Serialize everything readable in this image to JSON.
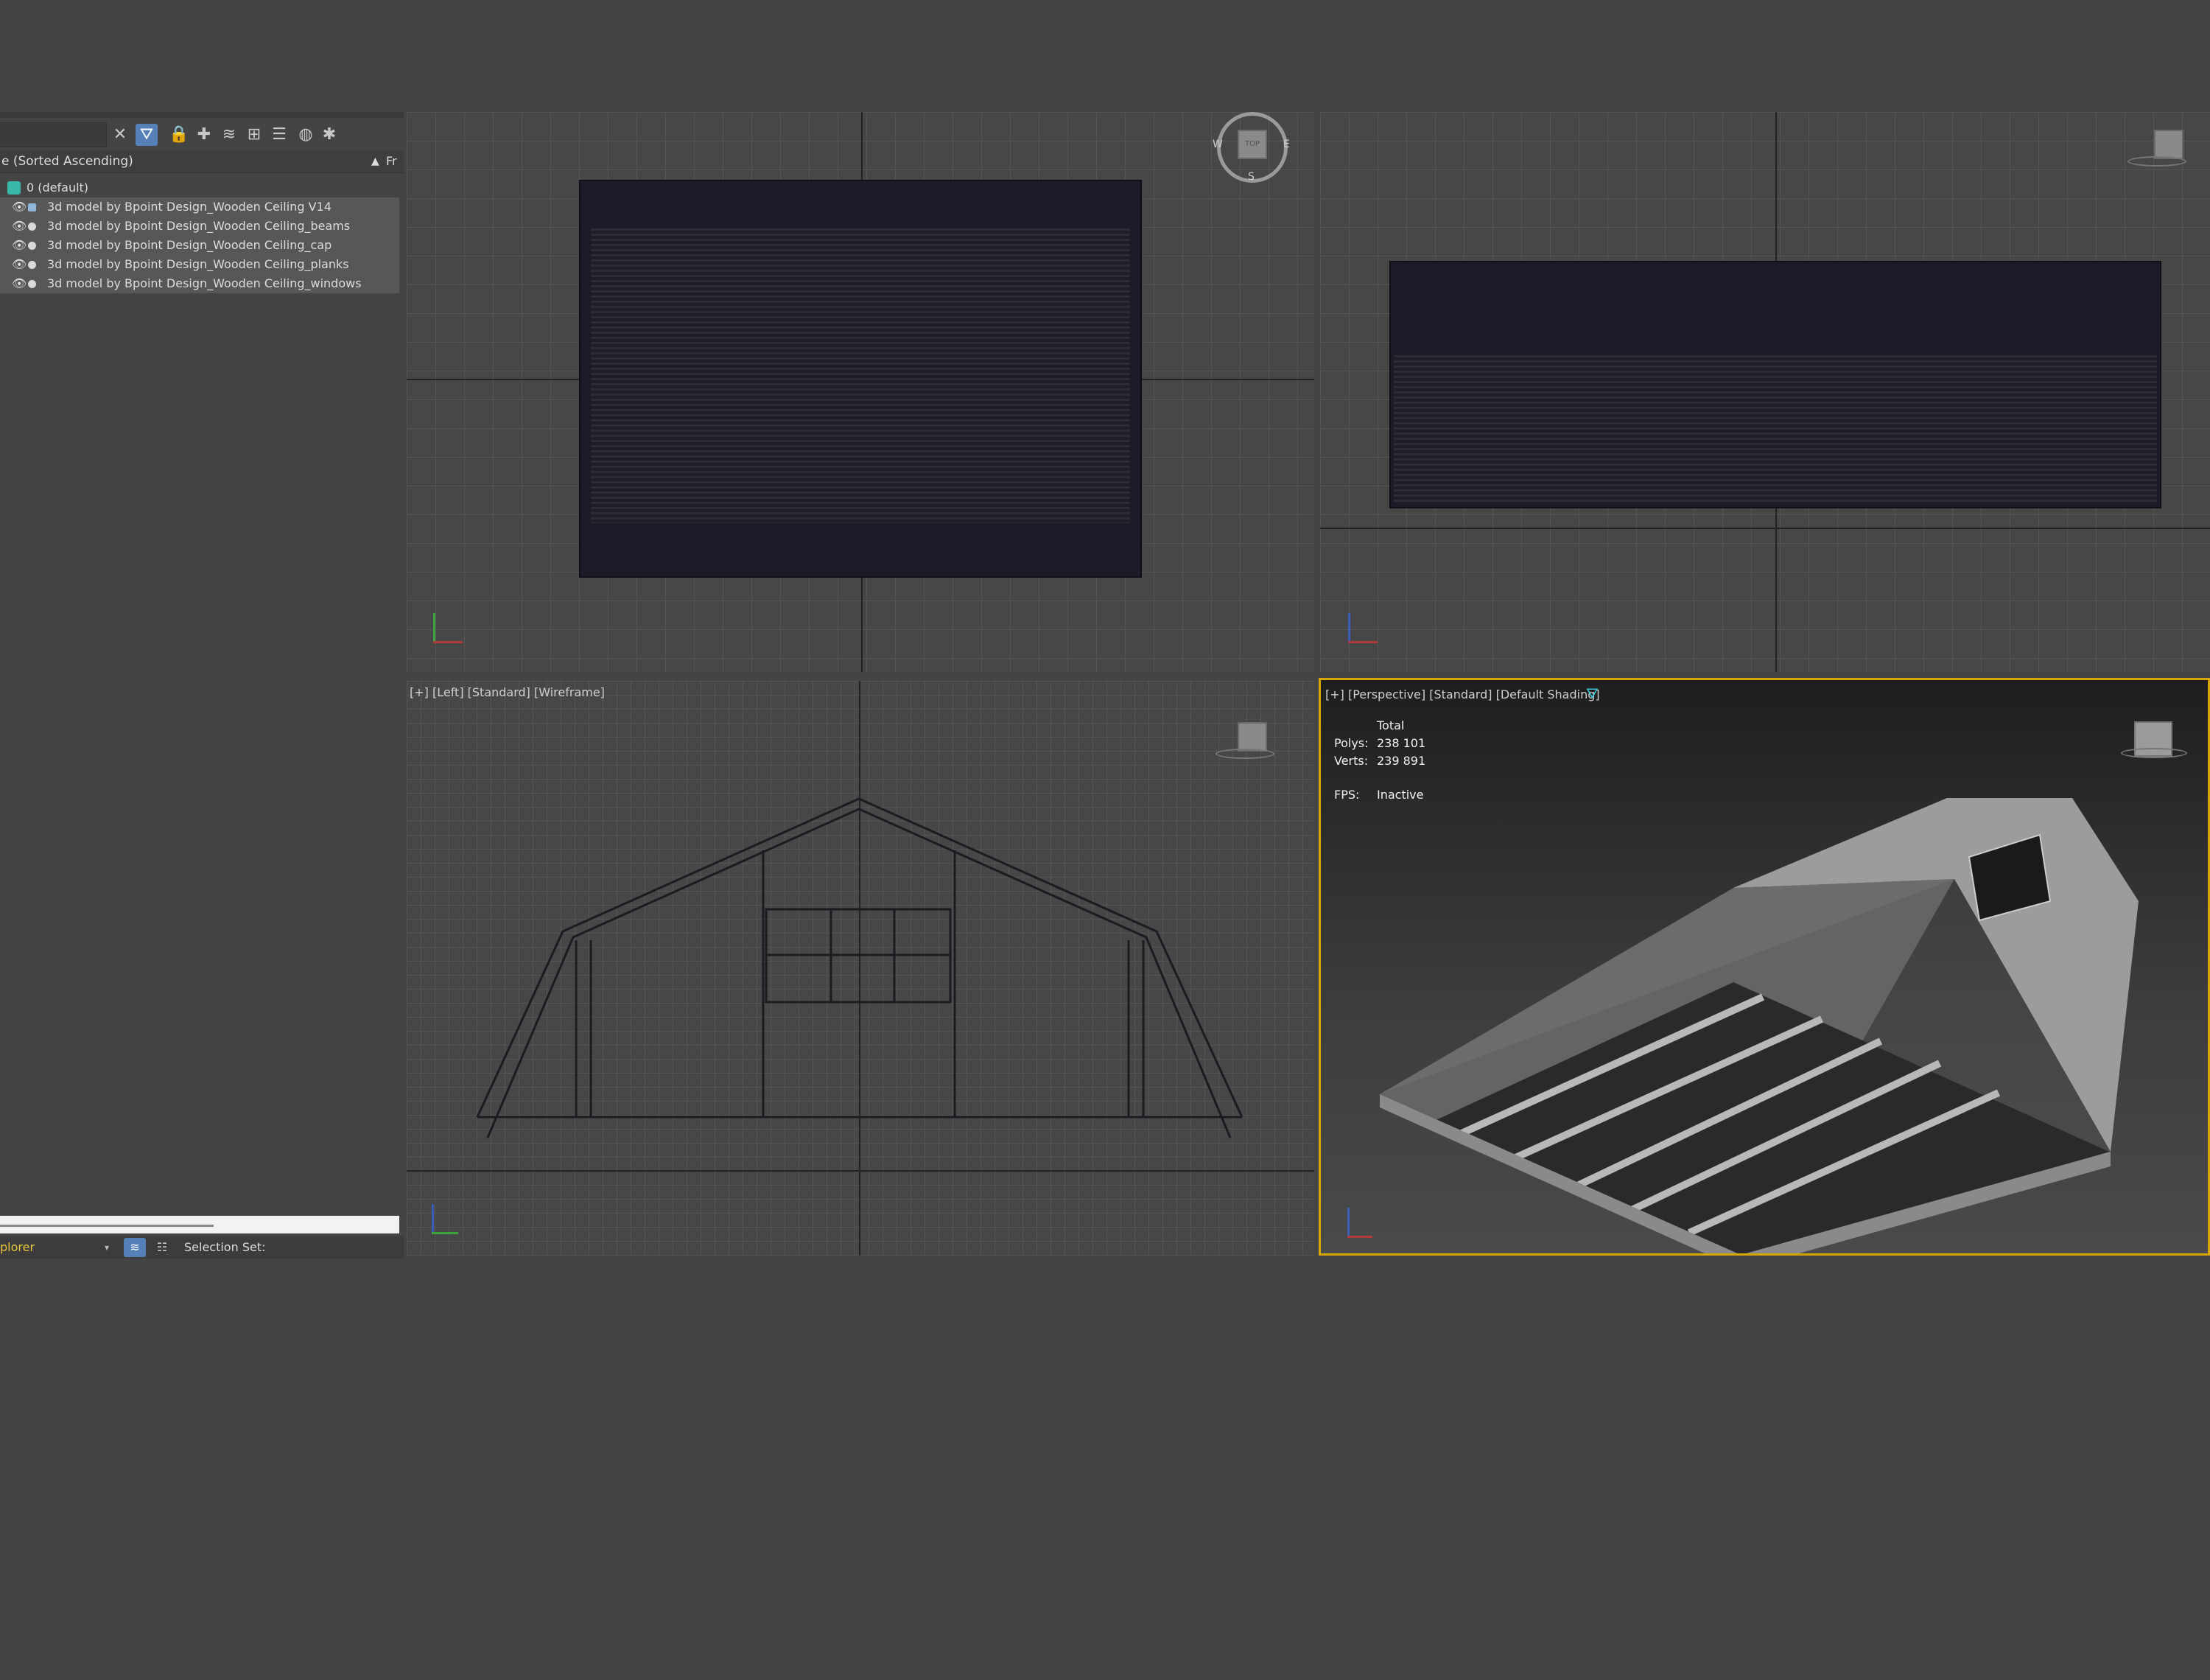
{
  "explorer": {
    "sort_label": "e (Sorted Ascending)",
    "sort_arrow": "▲",
    "column_fr": "Fr",
    "layer": "0 (default)",
    "items": [
      {
        "label": "3d model by Bpoint Design_Wooden Ceiling V14"
      },
      {
        "label": "3d model by Bpoint Design_Wooden Ceiling_beams"
      },
      {
        "label": "3d model by Bpoint Design_Wooden Ceiling_cap"
      },
      {
        "label": "3d model by Bpoint Design_Wooden Ceiling_planks"
      },
      {
        "label": "3d model by Bpoint Design_Wooden Ceiling_windows"
      }
    ],
    "footer": {
      "name": "plorer",
      "selection_set": "Selection Set:"
    },
    "icons": [
      "close-icon",
      "filter-icon",
      "lock-icon",
      "add-object-icon",
      "layers-icon",
      "hierarchy-icon",
      "layer-stack-icon",
      "show-icon",
      "settings-icon"
    ]
  },
  "viewports": {
    "left_label": "[+] [Left] [Standard] [Wireframe]",
    "persp_label": "[+] [Perspective] [Standard] [Default Shading]",
    "viewcube_top": "TOP",
    "compass": {
      "w": "W",
      "e": "E",
      "s": "S"
    },
    "stats": {
      "header": "Total",
      "polys_label": "Polys:",
      "polys_value": "238 101",
      "verts_label": "Verts:",
      "verts_value": "239 891",
      "fps_label": "FPS:",
      "fps_value": "Inactive"
    }
  },
  "colors": {
    "active_viewport_border": "#d8a600",
    "accent_blue": "#5680b8",
    "layer_teal": "#39b7a8",
    "explorer_name": "#e8c83a"
  }
}
